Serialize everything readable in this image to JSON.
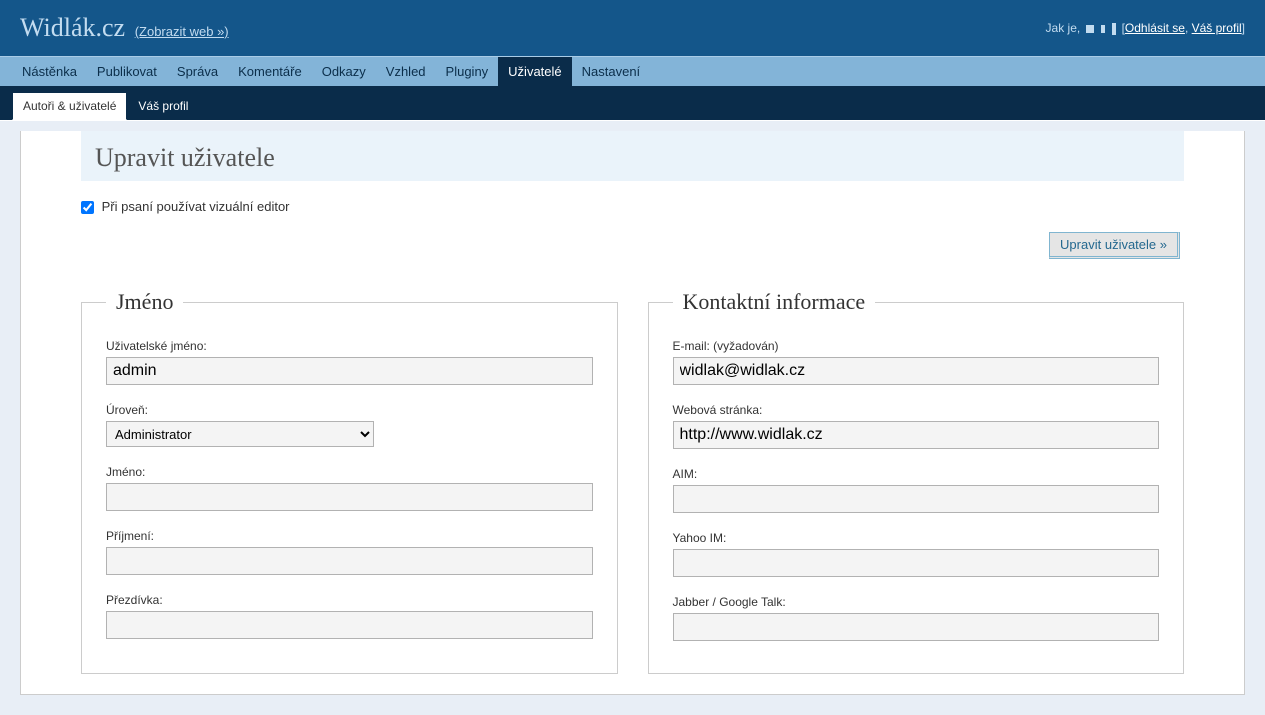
{
  "header": {
    "site_title": "Widlák.cz",
    "site_link_text": "(Zobrazit web »)",
    "greeting": "Jak je,",
    "logout_text": "Odhlásit se",
    "profile_text": "Váš profil"
  },
  "nav_primary": {
    "items": [
      {
        "label": "Nástěnka"
      },
      {
        "label": "Publikovat"
      },
      {
        "label": "Správa"
      },
      {
        "label": "Komentáře"
      },
      {
        "label": "Odkazy"
      },
      {
        "label": "Vzhled"
      },
      {
        "label": "Pluginy"
      },
      {
        "label": "Uživatelé",
        "active": true
      },
      {
        "label": "Nastavení"
      }
    ]
  },
  "nav_secondary": {
    "items": [
      {
        "label": "Autoři & uživatelé",
        "active": true
      },
      {
        "label": "Váš profil"
      }
    ]
  },
  "page": {
    "title": "Upravit uživatele",
    "visual_editor_label": "Při psaní používat vizuální editor",
    "submit_label": "Upravit uživatele »"
  },
  "fieldset_name": {
    "legend": "Jméno",
    "username_label": "Uživatelské jméno:",
    "username_value": "admin",
    "role_label": "Úroveň:",
    "role_value": "Administrator",
    "firstname_label": "Jméno:",
    "firstname_value": "",
    "lastname_label": "Příjmení:",
    "lastname_value": "",
    "nickname_label": "Přezdívka:",
    "nickname_value": ""
  },
  "fieldset_contact": {
    "legend": "Kontaktní informace",
    "email_label": "E-mail: (vyžadován)",
    "email_value": "widlak@widlak.cz",
    "website_label": "Webová stránka:",
    "website_value": "http://www.widlak.cz",
    "aim_label": "AIM:",
    "aim_value": "",
    "yim_label": "Yahoo IM:",
    "yim_value": "",
    "jabber_label": "Jabber / Google Talk:",
    "jabber_value": ""
  }
}
